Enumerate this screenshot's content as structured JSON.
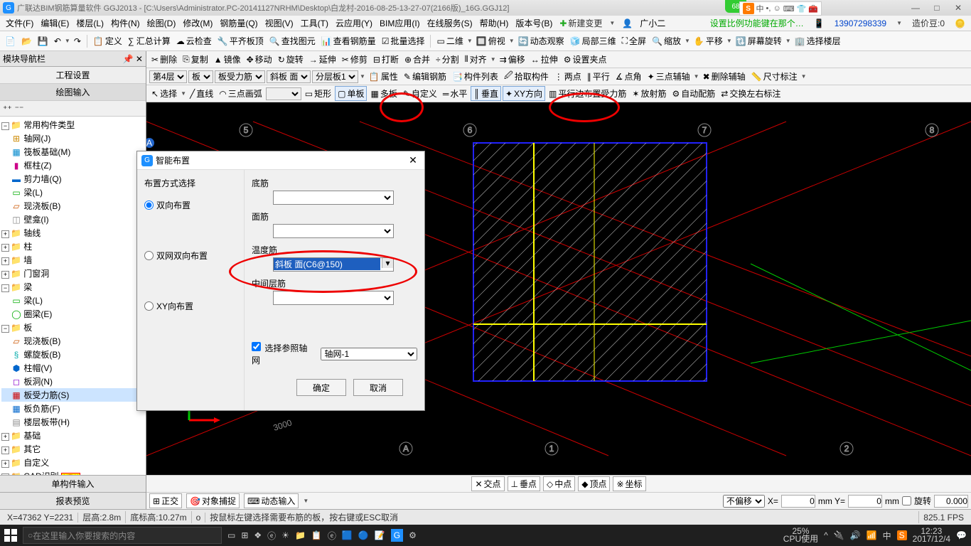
{
  "title": "广联达BIM钢筋算量软件 GGJ2013 - [C:\\Users\\Administrator.PC-20141127NRHM\\Desktop\\白龙村-2016-08-25-13-27-07(2166版)_16G.GGJ12]",
  "badge": "68",
  "menu": [
    "文件(F)",
    "编辑(E)",
    "楼层(L)",
    "构件(N)",
    "绘图(D)",
    "修改(M)",
    "钢筋量(Q)",
    "视图(V)",
    "工具(T)",
    "云应用(Y)",
    "BIM应用(I)",
    "在线服务(S)",
    "帮助(H)",
    "版本号(B)"
  ],
  "new_change": "新建变更",
  "username": "广小二",
  "tip": "设置比例功能键在那个…",
  "phone": "13907298339",
  "coin_label": "造价豆:0",
  "toolbar1": {
    "def": "定义",
    "sum": "∑ 汇总计算",
    "cloud": "云检查",
    "flat": "平齐板顶",
    "find": "查找图元",
    "view_rebar": "查看钢筋量",
    "batch": "批量选择",
    "two_d": "二维",
    "over": "俯视",
    "dyn": "动态观察",
    "local3d": "局部三维",
    "full": "全屏",
    "zoom": "缩放",
    "pan": "平移",
    "rot": "屏幕旋转",
    "sel_floor": "选择楼层"
  },
  "toolbar2": {
    "del": "删除",
    "copy": "复制",
    "mirror": "镜像",
    "move": "移动",
    "rotate": "旋转",
    "ext": "延伸",
    "trim": "修剪",
    "break": "打断",
    "merge": "合并",
    "split": "分割",
    "align": "对齐",
    "offset": "偏移",
    "stretch": "拉伸",
    "grip": "设置夹点"
  },
  "toolbar3": {
    "floor": "第4层",
    "comp": "板",
    "subtype": "板受力筋",
    "slope_face": "斜板 面",
    "layer": "分层板1",
    "props": "属性",
    "edit_rebar": "编辑钢筋",
    "comp_list": "构件列表",
    "pick": "拾取构件",
    "two_pt": "两点",
    "parallel": "平行",
    "pt_ang": "点角",
    "three_pt": "三点辅轴",
    "del_aux": "删除辅轴",
    "dim": "尺寸标注"
  },
  "toolbar4": {
    "select": "选择",
    "line": "直线",
    "arc": "三点画弧",
    "rect": "矩形",
    "single": "单板",
    "multi": "多板",
    "custom": "自定义",
    "horiz": "水平",
    "vert": "垂直",
    "xy": "XY方向",
    "parallel_edge": "平行边布置受力筋",
    "radiate": "放射筋",
    "auto": "自动配筋",
    "swap": "交换左右标注"
  },
  "left": {
    "nav_title": "模块导航栏",
    "proj": "工程设置",
    "draw_input": "绘图输入",
    "tree": {
      "root": "常用构件类型",
      "items1": [
        "轴网(J)",
        "筏板基础(M)",
        "框柱(Z)",
        "剪力墙(Q)",
        "梁(L)",
        "现浇板(B)",
        "壁龛(I)"
      ],
      "folders": [
        "轴线",
        "柱",
        "墙",
        "门窗洞",
        "梁"
      ],
      "beam_items": [
        "梁(L)",
        "圈梁(E)"
      ],
      "board": "板",
      "board_items": [
        "现浇板(B)",
        "螺旋板(B)",
        "柱帽(V)",
        "板洞(N)",
        "板受力筋(S)",
        "板负筋(F)",
        "楼层板带(H)"
      ],
      "rest": [
        "基础",
        "其它",
        "自定义",
        "CAD识别"
      ]
    },
    "single_input": "单构件输入",
    "preview": "报表预览"
  },
  "dialog": {
    "title": "智能布置",
    "layout_method": "布置方式选择",
    "opt1": "双向布置",
    "opt2": "双网双向布置",
    "opt3": "XY向布置",
    "f1": "底筋",
    "f2": "面筋",
    "f3": "温度筋",
    "f3_val": "斜板 面(C6@150)",
    "f4": "中间层筋",
    "ref_check": "选择参照轴网",
    "ref_val": "轴网-1",
    "ok": "确定",
    "cancel": "取消"
  },
  "osnap": {
    "cross": "交点",
    "perp": "垂点",
    "mid": "中点",
    "vertex": "顶点",
    "coord": "坐标"
  },
  "lower": {
    "ortho": "正交",
    "obj_snap": "对象捕捉",
    "dyn_inp": "动态输入",
    "no_offset": "不偏移",
    "x_lbl": "X=",
    "x_val": "0",
    "y_lbl": "mm Y=",
    "y_val": "0",
    "mm": "mm",
    "rot": "旋转",
    "rot_val": "0.000"
  },
  "status": {
    "coord": "X=47362 Y=2231",
    "floor_h": "层高:2.8m",
    "bottom_h": "底标高:10.27m",
    "o": "o",
    "hint": "按鼠标左键选择需要布筋的板，按右键或ESC取消",
    "fps": "825.1 FPS"
  },
  "taskbar": {
    "search": "在这里输入你要搜索的内容",
    "cpu": "25%",
    "cpu_lbl": "CPU使用",
    "time": "12:23",
    "date": "2017/12/4"
  },
  "ime": {
    "zh": "中",
    "punct": "•,",
    "smile": "☺"
  }
}
